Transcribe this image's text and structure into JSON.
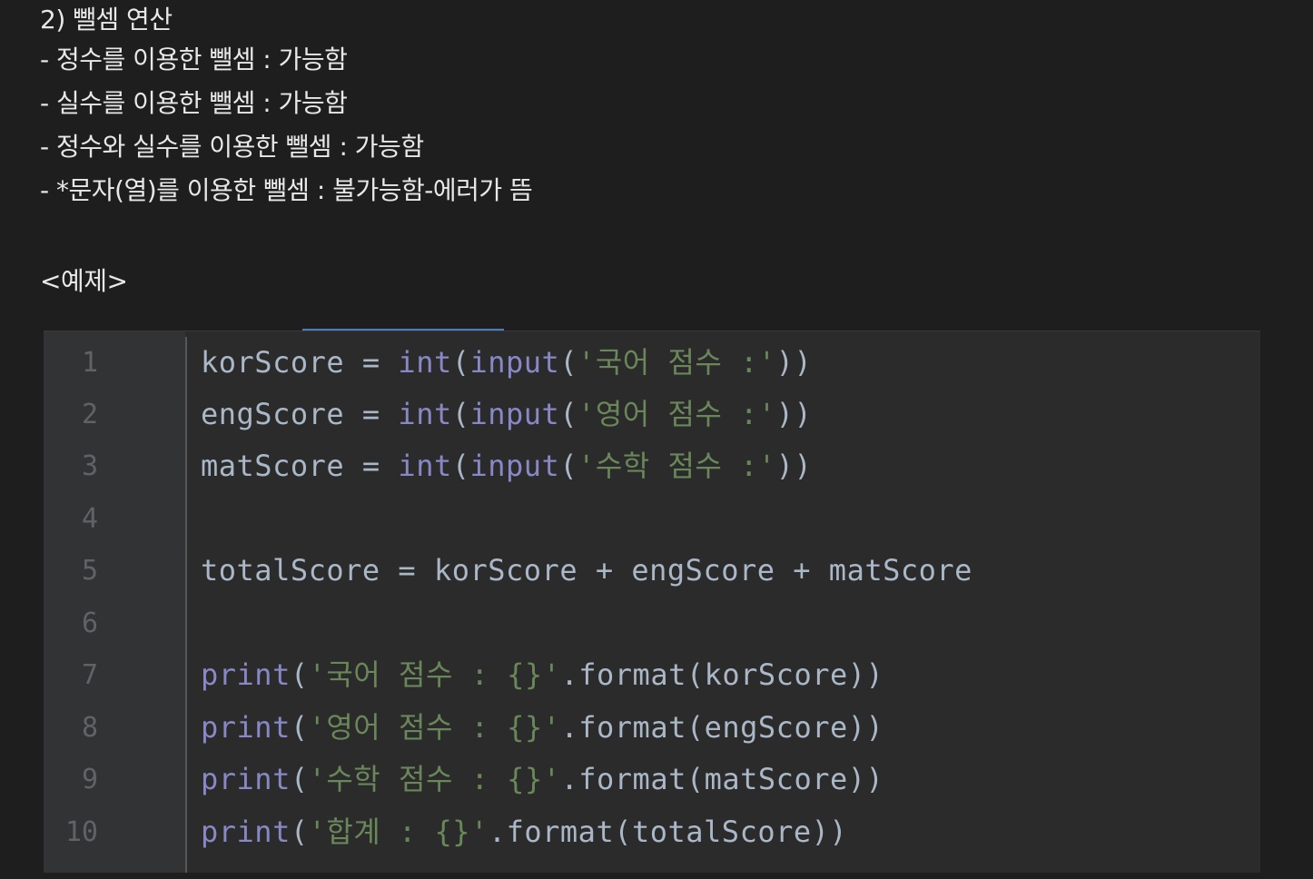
{
  "notes": {
    "heading": "2) 뺄셈 연산",
    "lines": [
      "- 정수를 이용한 뺄셈 : 가능함",
      "- 실수를 이용한 뺄셈 : 가능함",
      "- 정수와 실수를 이용한 뺄셈 : 가능함",
      "- *문자(열)를 이용한 뺄셈 : 불가능함-에러가 뜸"
    ],
    "example_label": "<예제>"
  },
  "editor": {
    "line_numbers": [
      "1",
      "2",
      "3",
      "4",
      "5",
      "6",
      "7",
      "8",
      "9",
      "10"
    ],
    "code": {
      "l1": {
        "var": "korScore = ",
        "int": "int",
        "p1": "(",
        "input": "input",
        "p2": "(",
        "str": "'국어 점수 :'",
        "end": "))"
      },
      "l2": {
        "var": "engScore = ",
        "int": "int",
        "p1": "(",
        "input": "input",
        "p2": "(",
        "str": "'영어 점수 :'",
        "end": "))"
      },
      "l3": {
        "var": "matScore = ",
        "int": "int",
        "p1": "(",
        "input": "input",
        "p2": "(",
        "str": "'수학 점수 :'",
        "end": "))"
      },
      "l5": {
        "text": "totalScore = korScore + engScore + matScore"
      },
      "l7": {
        "print": "print",
        "p": "(",
        "str": "'국어 점수 : {}'",
        "rest": ".format(korScore))"
      },
      "l8": {
        "print": "print",
        "p": "(",
        "str": "'영어 점수 : {}'",
        "rest": ".format(engScore))"
      },
      "l9": {
        "print": "print",
        "p": "(",
        "str": "'수학 점수 : {}'",
        "rest": ".format(matScore))"
      },
      "l10": {
        "print": "print",
        "p": "(",
        "str": "'합계 : {}'",
        "rest": ".format(totalScore))"
      }
    }
  }
}
